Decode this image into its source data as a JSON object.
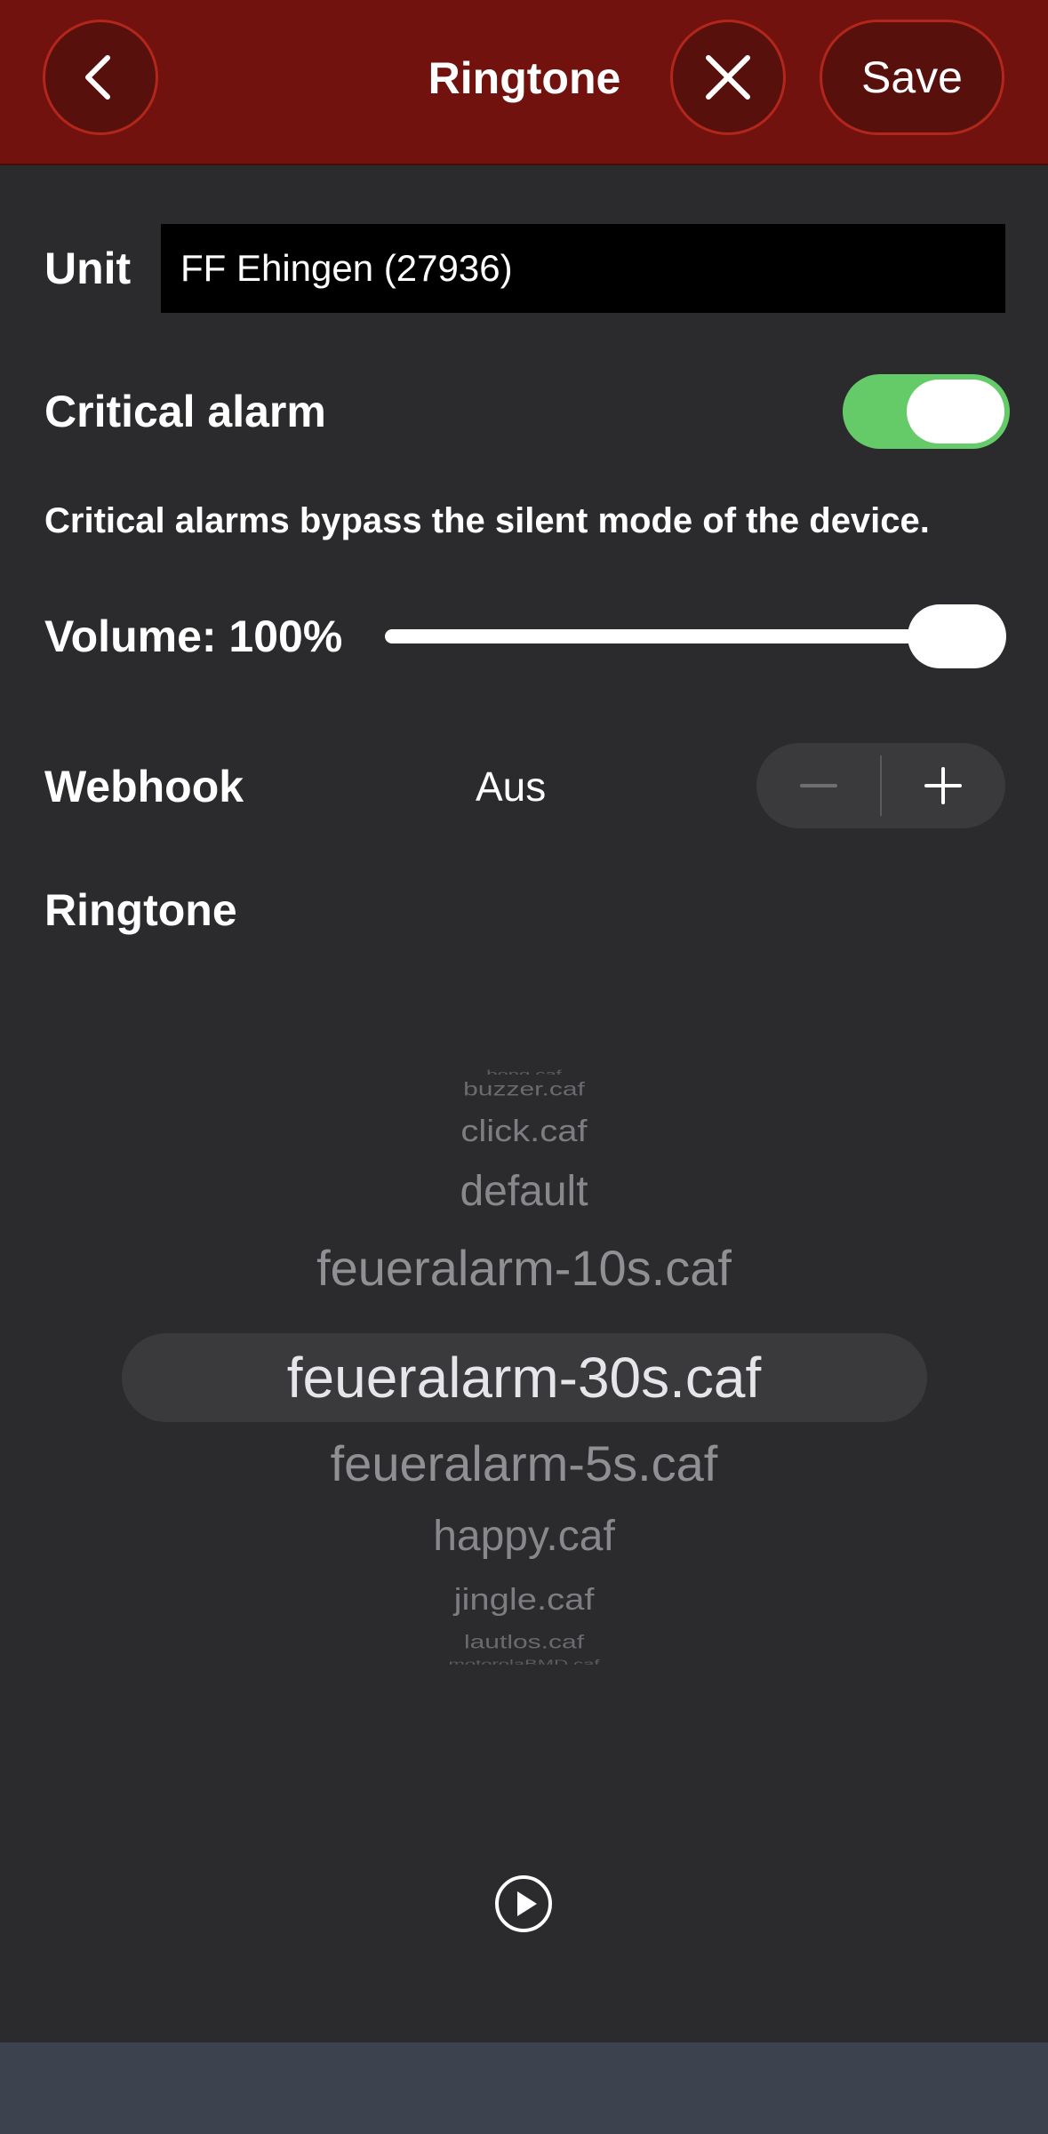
{
  "header": {
    "title": "Ringtone",
    "save_label": "Save",
    "back_icon": "chevron-left-icon",
    "close_icon": "close-icon"
  },
  "unit": {
    "label": "Unit",
    "value": "FF Ehingen (27936)"
  },
  "critical_alarm": {
    "label": "Critical alarm",
    "enabled": true,
    "note": "Critical alarms bypass the silent mode of the device."
  },
  "volume": {
    "label": "Volume: 100%",
    "value_percent": 100
  },
  "webhook": {
    "label": "Webhook",
    "value": "Aus",
    "minus_icon": "minus-icon",
    "plus_icon": "plus-icon"
  },
  "ringtone": {
    "label": "Ringtone",
    "options": [
      "bong.caf",
      "buzzer.caf",
      "click.caf",
      "default",
      "feueralarm-10s.caf",
      "feueralarm-30s.caf",
      "feueralarm-5s.caf",
      "happy.caf",
      "jingle.caf",
      "lautlos.caf",
      "motorolaBMD.caf"
    ],
    "selected": "feueralarm-30s.caf",
    "play_icon": "play-circle-icon"
  },
  "colors": {
    "nav_background": "#72120e",
    "button_border": "#b3261c",
    "toggle_on": "#65cb69",
    "page_background": "#2b2b2d"
  }
}
